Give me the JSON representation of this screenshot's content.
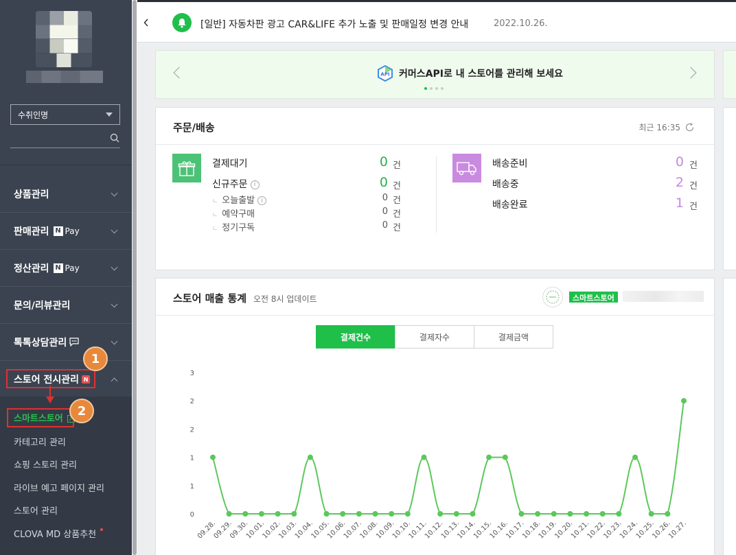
{
  "sidebar": {
    "dropdown_value": "수취인명",
    "menu": [
      {
        "label": "상품관리"
      },
      {
        "label": "판매관리",
        "npay": "Pay"
      },
      {
        "label": "정산관리",
        "npay": "Pay"
      },
      {
        "label": "문의/리뷰관리"
      },
      {
        "label": "톡톡상담관리"
      },
      {
        "label": "스토어 전시관리",
        "badge": "N"
      }
    ],
    "npay_n": "N",
    "submenu": [
      {
        "label": "스마트스토어"
      },
      {
        "label": "카테고리 관리"
      },
      {
        "label": "쇼핑 스토리 관리"
      },
      {
        "label": "라이브 예고 페이지 관리"
      },
      {
        "label": "스토어 관리"
      },
      {
        "label": "CLOVA MD 상품추천"
      }
    ]
  },
  "annotations": {
    "step1": "1",
    "step2": "2",
    "color": "#e03030"
  },
  "notice": {
    "text": "[일반] 자동차판 광고 CAR&LIFE 추가 노출 및 판매일정 변경 안내",
    "date": "2022.10.26."
  },
  "banner": {
    "title": "커머스API로 내 스토어를 관리해 보세요",
    "api_label": "API"
  },
  "orders": {
    "title": "주문/배송",
    "recent": "최근 16:35",
    "unit": "건",
    "left": [
      {
        "label": "결제대기",
        "count": "0"
      },
      {
        "label": "신규주문",
        "count": "0"
      }
    ],
    "left_sub": [
      {
        "label": "오늘출발",
        "count": "0"
      },
      {
        "label": "예약구매",
        "count": "0"
      },
      {
        "label": "정기구독",
        "count": "0"
      }
    ],
    "right": [
      {
        "label": "배송준비",
        "count": "0"
      },
      {
        "label": "배송중",
        "count": "2"
      },
      {
        "label": "배송완료",
        "count": "1"
      }
    ]
  },
  "stats": {
    "title": "스토어 매출 통계",
    "sub": "오전 8시 업데이트",
    "store_tag": "스마트스토어",
    "tabs": [
      "결제건수",
      "결제자수",
      "결제금액"
    ],
    "active_tab": 0
  },
  "colors": {
    "accent": "#1fbf4a",
    "line": "#5ac85a",
    "purple": "#c28ade",
    "sidebar": "#3b4350"
  },
  "chart_data": {
    "type": "line",
    "x": [
      "09.28.",
      "09.29.",
      "09.30.",
      "10.01.",
      "10.02.",
      "10.03.",
      "10.04.",
      "10.05.",
      "10.06.",
      "10.07.",
      "10.08.",
      "10.09.",
      "10.10.",
      "10.11.",
      "10.12.",
      "10.13.",
      "10.14.",
      "10.15.",
      "10.16.",
      "10.17.",
      "10.18.",
      "10.19.",
      "10.20.",
      "10.21.",
      "10.22.",
      "10.23.",
      "10.24.",
      "10.25.",
      "10.26.",
      "10.27."
    ],
    "series": [
      {
        "values": [
          1,
          0,
          0,
          0,
          0,
          0,
          1,
          0,
          0,
          0,
          0,
          0,
          0,
          1,
          0,
          0,
          0,
          1,
          1,
          0,
          0,
          0,
          0,
          0,
          0,
          0,
          1,
          0,
          0,
          2
        ]
      }
    ],
    "y_ticks": [
      "0",
      "1",
      "1",
      "2",
      "2",
      "3"
    ],
    "ylim": [
      0,
      2.5
    ],
    "grid": false
  }
}
